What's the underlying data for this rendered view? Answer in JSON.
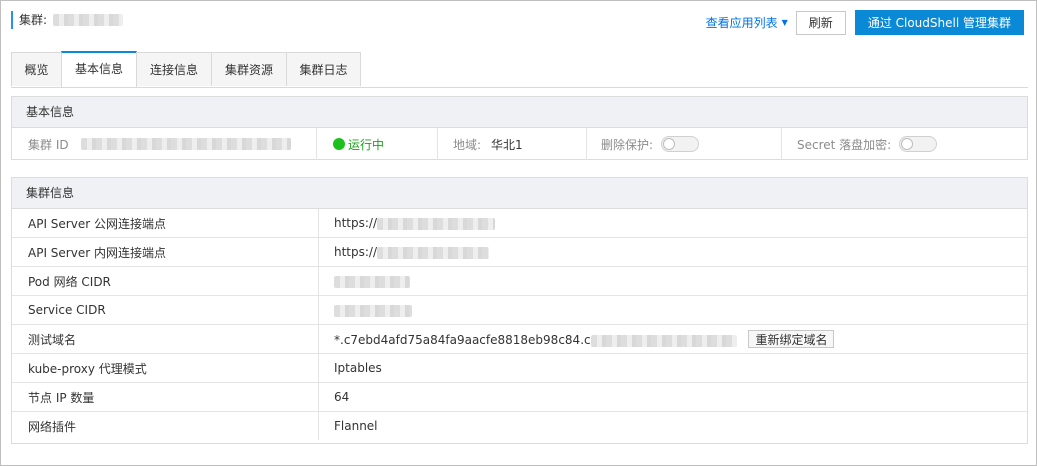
{
  "header": {
    "cluster_label": "集群:",
    "app_list_link": "查看应用列表",
    "refresh_button": "刷新",
    "cloudshell_button": "通过 CloudShell 管理集群"
  },
  "tabs": [
    {
      "label": "概览",
      "active": false
    },
    {
      "label": "基本信息",
      "active": true
    },
    {
      "label": "连接信息",
      "active": false
    },
    {
      "label": "集群资源",
      "active": false
    },
    {
      "label": "集群日志",
      "active": false
    }
  ],
  "basic_info": {
    "title": "基本信息",
    "cluster_id_label": "集群 ID",
    "status": "运行中",
    "region_label": "地域:",
    "region_value": "华北1",
    "delete_protection_label": "删除保护:",
    "delete_protection_on": false,
    "secret_encryption_label": "Secret 落盘加密:",
    "secret_encryption_on": false
  },
  "cluster_info": {
    "title": "集群信息",
    "rows": [
      {
        "key": "API Server 公网连接端点",
        "value": "https://"
      },
      {
        "key": "API Server 内网连接端点",
        "value": "https://"
      },
      {
        "key": "Pod 网络 CIDR",
        "value": ""
      },
      {
        "key": "Service CIDR",
        "value": ""
      },
      {
        "key": "测试域名",
        "value": "*.c7ebd4afd75a84fa9aacfe8818eb98c84.c"
      },
      {
        "key": "kube-proxy 代理模式",
        "value": "Iptables"
      },
      {
        "key": "节点 IP 数量",
        "value": "64"
      },
      {
        "key": "网络插件",
        "value": "Flannel"
      }
    ],
    "rebind_button": "重新绑定域名"
  },
  "colors": {
    "primary": "#0a8ad6",
    "link": "#0073e6",
    "running": "#1dc11d"
  }
}
